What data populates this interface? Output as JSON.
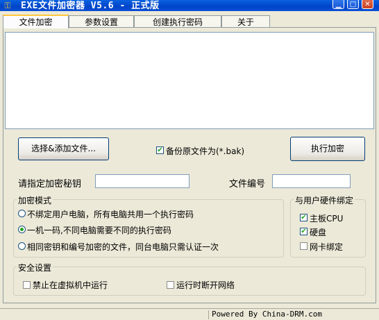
{
  "window": {
    "title": "EXE文件加密器 V5.6 - 正式版",
    "icon": "app-key-icon",
    "controls": [
      "minimize",
      "maximize",
      "close"
    ]
  },
  "tabs": [
    {
      "label": "文件加密",
      "active": true
    },
    {
      "label": "参数设置",
      "active": false
    },
    {
      "label": "创建执行密码",
      "active": false
    },
    {
      "label": "关于",
      "active": false
    }
  ],
  "actions": {
    "select_files_label": "选择&添加文件...",
    "backup_label": "备份原文件为(*.bak)",
    "backup_checked": true,
    "encrypt_label": "执行加密"
  },
  "fields": {
    "secret_key_label": "请指定加密秘钥",
    "secret_key_value": "",
    "file_number_label": "文件编号",
    "file_number_value": ""
  },
  "encrypt_mode": {
    "title": "加密模式",
    "options": [
      {
        "label": "不绑定用户电脑，所有电脑共用一个执行密码",
        "selected": false
      },
      {
        "label": "一机一码,不同电脑需要不同的执行密码",
        "selected": true
      },
      {
        "label": "相同密钥和编号加密的文件，同台电脑只需认证一次",
        "selected": false
      }
    ]
  },
  "hardware_binding": {
    "title": "与用户硬件绑定",
    "options": [
      {
        "label": "主板CPU",
        "checked": true
      },
      {
        "label": "硬盘",
        "checked": true
      },
      {
        "label": "网卡绑定",
        "checked": false
      }
    ]
  },
  "security": {
    "title": "安全设置",
    "options": [
      {
        "label": "禁止在虚拟机中运行",
        "checked": false
      },
      {
        "label": "运行时断开网络",
        "checked": false
      }
    ]
  },
  "status": {
    "powered_by": "Powered By China-DRM.com"
  },
  "colors": {
    "titlebar": "#0044c8",
    "window_bg": "#ece9d8",
    "check_mark": "#21a121",
    "tab_highlight": "#ffc83c"
  }
}
